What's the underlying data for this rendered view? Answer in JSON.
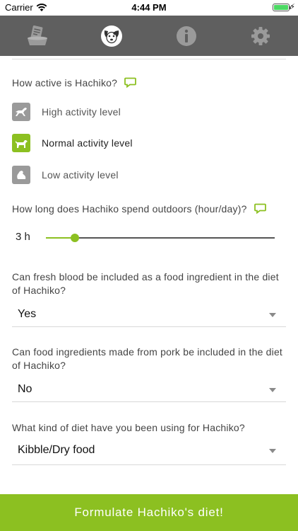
{
  "status_bar": {
    "carrier": "Carrier",
    "time": "4:44 PM",
    "battery_level": 1.0
  },
  "tabs": [
    {
      "icon": "food-bowl-icon",
      "active": false
    },
    {
      "icon": "dog-face-icon",
      "active": true
    },
    {
      "icon": "info-icon",
      "active": false
    },
    {
      "icon": "gear-icon",
      "active": false
    }
  ],
  "activity": {
    "question": "How active is Hachiko?",
    "options": [
      {
        "label": "High activity level",
        "icon": "running-dog-icon",
        "selected": false
      },
      {
        "label": "Normal activity level",
        "icon": "walking-dog-icon",
        "selected": true
      },
      {
        "label": "Low activity level",
        "icon": "sitting-dog-icon",
        "selected": false
      }
    ]
  },
  "outdoors": {
    "question": "How long does Hachiko spend outdoors (hour/day)?",
    "value_label": "3 h",
    "value": 3,
    "fraction": 0.125
  },
  "fresh_blood": {
    "question": "Can fresh blood be included as a food ingredient in the diet of Hachiko?",
    "value": "Yes"
  },
  "pork": {
    "question": "Can food ingredients made from pork be included in the diet of Hachiko?",
    "value": "No"
  },
  "diet": {
    "question": "What kind of diet have you been using for Hachiko?",
    "value": "Kibble/Dry food"
  },
  "cta": {
    "label": "Formulate Hachiko's diet!"
  },
  "colors": {
    "accent": "#8cc021",
    "tabbar": "#5f5f5f",
    "icon_inactive": "#9a9a9a"
  }
}
